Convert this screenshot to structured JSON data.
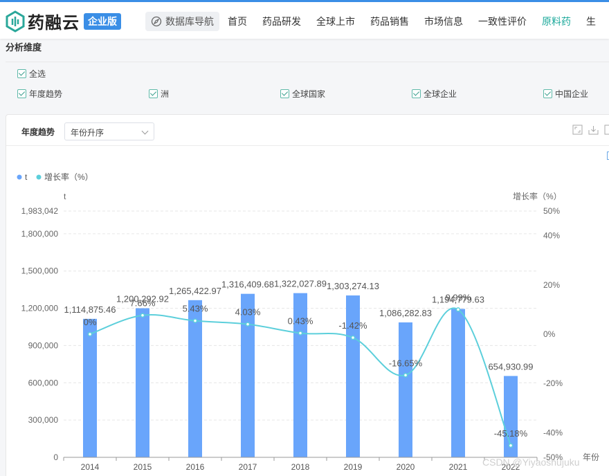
{
  "brand": {
    "name": "药融云",
    "edition": "企业版"
  },
  "nav": {
    "db_nav_label": "数据库导航",
    "items": [
      "首页",
      "药品研发",
      "全球上市",
      "药品销售",
      "市场信息",
      "一致性评价",
      "原料药",
      "生"
    ],
    "active_index": 6
  },
  "filters": {
    "section_title": "分析维度",
    "select_all_label": "全选",
    "options": [
      "年度趋势",
      "洲",
      "全球国家",
      "全球企业",
      "中国企业"
    ]
  },
  "panel": {
    "title": "年度趋势",
    "sort_value": "年份升序"
  },
  "colors": {
    "accent": "#3a8ee6",
    "bar": "#69a5fb",
    "line": "#5ccfdb",
    "active_menu": "#1aa89a"
  },
  "chart_data": {
    "type": "bar",
    "categories": [
      "2014",
      "2015",
      "2016",
      "2017",
      "2018",
      "2019",
      "2020",
      "2021",
      "2022"
    ],
    "series": [
      {
        "name": "t",
        "type": "bar",
        "axis": "left",
        "values": [
          1114875.46,
          1200292.92,
          1265422.97,
          1316409.68,
          1322027.89,
          1303274.13,
          1086282.83,
          1194779.63,
          654930.99
        ],
        "labels": [
          "1,114,875.46",
          "1,200,292.92",
          "1,265,422.97",
          "1,316,409.68",
          "1,322,027.89",
          "1,303,274.13",
          "1,086,282.83",
          "1,194,779.63",
          "654,930.99"
        ]
      },
      {
        "name": "增长率（%）",
        "type": "line",
        "axis": "right",
        "values": [
          0,
          7.66,
          5.43,
          4.03,
          0.43,
          -1.42,
          -16.65,
          9.99,
          -45.18
        ],
        "labels": [
          "0%",
          "7.66%",
          "5.43%",
          "4.03%",
          "0.43%",
          "-1.42%",
          "-16.65%",
          "9.99%",
          "-45.18%"
        ]
      }
    ],
    "y_left": {
      "label": "t",
      "ticks": [
        "0",
        "300,000",
        "600,000",
        "900,000",
        "1,200,000",
        "1,500,000",
        "1,800,000",
        "1,983,042"
      ],
      "tick_values": [
        0,
        300000,
        600000,
        900000,
        1200000,
        1500000,
        1800000,
        1983042
      ],
      "range": [
        0,
        1983042
      ]
    },
    "y_right": {
      "label": "增长率（%）",
      "ticks": [
        "-50%",
        "-40%",
        "-20%",
        "0%",
        "20%",
        "40%",
        "50%"
      ],
      "tick_values": [
        -50,
        -40,
        -20,
        0,
        20,
        40,
        50
      ],
      "range": [
        -50,
        50
      ]
    },
    "xlabel": "年份",
    "grid": true,
    "legend_position": "top-left"
  },
  "watermark": "CSDN @Yiyaoshujuku"
}
